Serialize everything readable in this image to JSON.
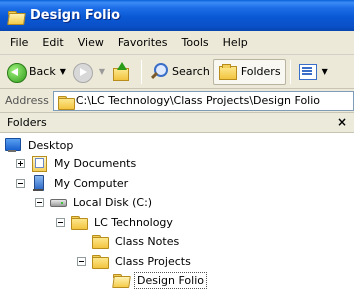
{
  "window": {
    "title": "Design Folio"
  },
  "menu": {
    "items": [
      "File",
      "Edit",
      "View",
      "Favorites",
      "Tools",
      "Help"
    ]
  },
  "toolbar": {
    "back_label": "Back",
    "search_label": "Search",
    "folders_label": "Folders"
  },
  "address": {
    "label": "Address",
    "value": "C:\\LC Technology\\Class Projects\\Design Folio"
  },
  "folders_pane": {
    "title": "Folders",
    "close_glyph": "×"
  },
  "tree": [
    {
      "label": "Desktop",
      "icon": "desktop-icon",
      "expander": "none"
    },
    {
      "label": "My Documents",
      "icon": "my-documents-icon",
      "expander": "plus"
    },
    {
      "label": "My Computer",
      "icon": "my-computer-icon",
      "expander": "minus"
    },
    {
      "label": "Local Disk (C:)",
      "icon": "hard-disk-icon",
      "expander": "minus"
    },
    {
      "label": "LC Technology",
      "icon": "folder-icon",
      "expander": "minus"
    },
    {
      "label": "Class Notes",
      "icon": "folder-icon",
      "expander": "none"
    },
    {
      "label": "Class Projects",
      "icon": "folder-icon",
      "expander": "minus"
    },
    {
      "label": "Design Folio",
      "icon": "open-folder-icon",
      "expander": "none",
      "selected": true
    }
  ]
}
